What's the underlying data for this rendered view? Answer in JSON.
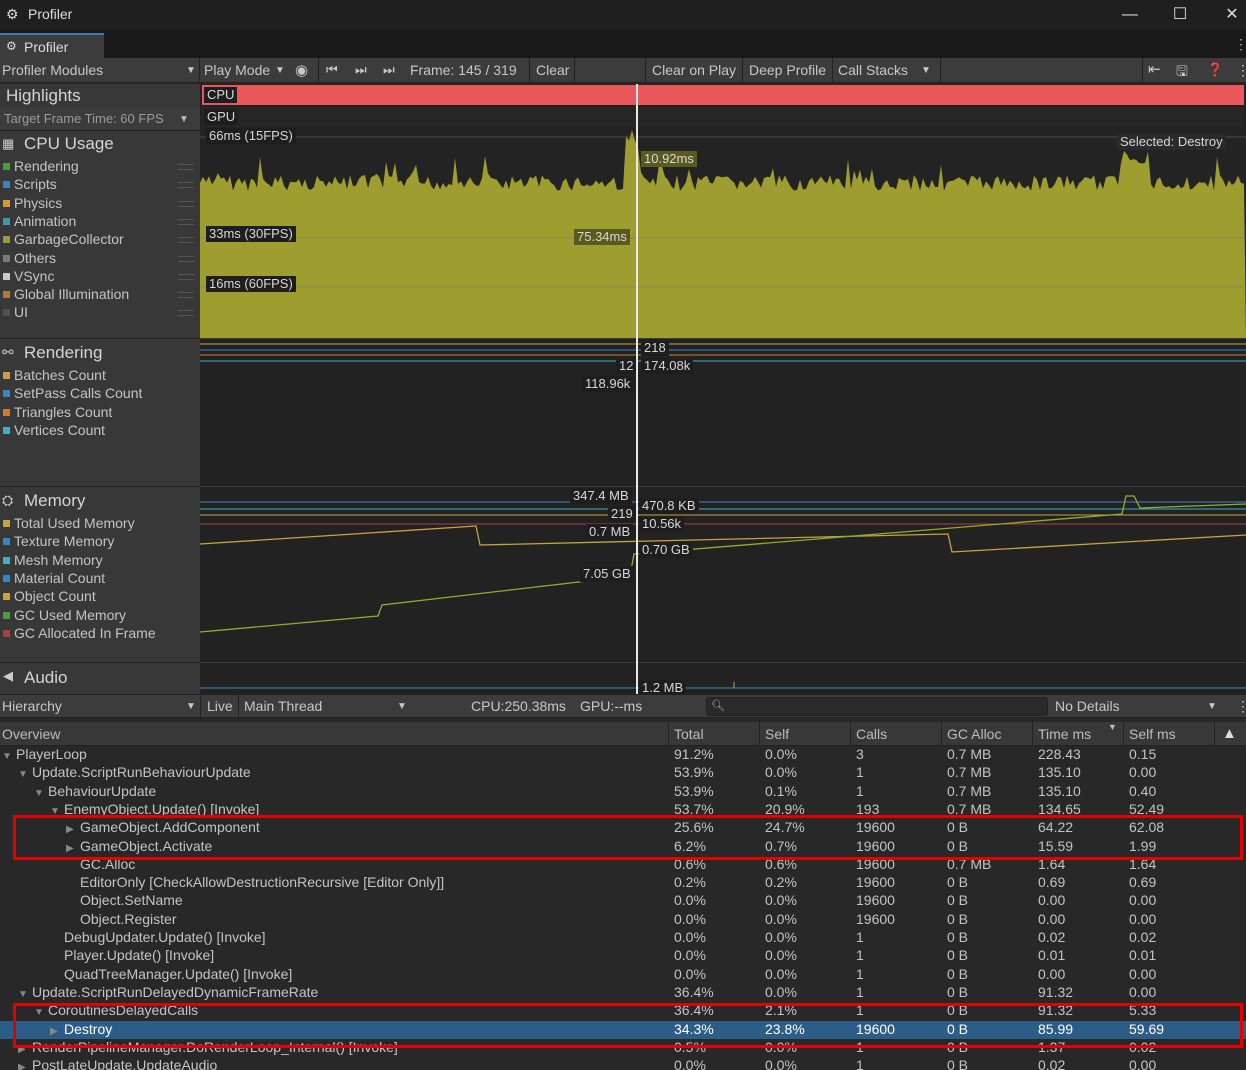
{
  "window": {
    "title": "Profiler",
    "tab": "Profiler"
  },
  "toolbar": {
    "modules": "Profiler Modules",
    "play_mode": "Play Mode",
    "frame": "Frame: 145 / 319",
    "clear": "Clear",
    "clear_on_play": "Clear on Play",
    "deep_profile": "Deep Profile",
    "call_stacks": "Call Stacks"
  },
  "highlights": {
    "title": "Highlights",
    "target": "Target Frame Time: 60 FPS",
    "cpu": "CPU",
    "gpu": "GPU"
  },
  "cpu_module": {
    "title": "CPU Usage",
    "legend": [
      {
        "label": "Rendering",
        "color": "#4e9a3d"
      },
      {
        "label": "Scripts",
        "color": "#3b84c4"
      },
      {
        "label": "Physics",
        "color": "#d09b2b"
      },
      {
        "label": "Animation",
        "color": "#3d99a6"
      },
      {
        "label": "GarbageCollector",
        "color": "#9a9a3d"
      },
      {
        "label": "Others",
        "color": "#7a7a7a"
      },
      {
        "label": "VSync",
        "color": "#c8c8c8"
      },
      {
        "label": "Global Illumination",
        "color": "#b07a3d"
      },
      {
        "label": "UI",
        "color": "#505050"
      }
    ],
    "labels": {
      "fps15": "66ms (15FPS)",
      "fps30": "33ms (30FPS)",
      "fps60": "16ms (60FPS)",
      "selected": "Selected: Destroy",
      "val1": "10.92ms",
      "val2": "75.34ms"
    }
  },
  "rendering_module": {
    "title": "Rendering",
    "legend": [
      {
        "label": "Batches Count",
        "color": "#c8a33d"
      },
      {
        "label": "SetPass Calls Count",
        "color": "#3b84c4"
      },
      {
        "label": "Triangles Count",
        "color": "#d07a2b"
      },
      {
        "label": "Vertices Count",
        "color": "#3db0c4"
      }
    ],
    "labels": {
      "a": "218",
      "b": "12",
      "c": "174.08k",
      "d": "118.96k"
    }
  },
  "memory_module": {
    "title": "Memory",
    "legend": [
      {
        "label": "Total Used Memory",
        "color": "#c8a33d"
      },
      {
        "label": "Texture Memory",
        "color": "#3b84c4"
      },
      {
        "label": "Mesh Memory",
        "color": "#3db0c4"
      },
      {
        "label": "Material Count",
        "color": "#3b84c4"
      },
      {
        "label": "Object Count",
        "color": "#c8a33d"
      },
      {
        "label": "GC Used Memory",
        "color": "#4e9a3d"
      },
      {
        "label": "GC Allocated In Frame",
        "color": "#b03d3d"
      }
    ],
    "labels": {
      "a": "347.4 MB",
      "b": "219",
      "c": "0.7 MB",
      "d": "7.05 GB",
      "e": "470.8 KB",
      "f": "10.56k",
      "g": "0.70 GB"
    }
  },
  "audio_module": {
    "title": "Audio",
    "label": "1.2 MB"
  },
  "hierarchy_bar": {
    "view": "Hierarchy",
    "live": "Live",
    "thread": "Main Thread",
    "cpu": "CPU:250.38ms",
    "gpu": "GPU:--ms",
    "details": "No Details"
  },
  "columns": [
    "Overview",
    "Total",
    "Self",
    "Calls",
    "GC Alloc",
    "Time ms",
    "Self ms"
  ],
  "rows": [
    {
      "indent": 0,
      "arrow": "▼",
      "name": "PlayerLoop",
      "total": "91.2%",
      "self": "0.0%",
      "calls": "3",
      "gc": "0.7 MB",
      "time": "228.43",
      "selfms": "0.15"
    },
    {
      "indent": 1,
      "arrow": "▼",
      "name": "Update.ScriptRunBehaviourUpdate",
      "total": "53.9%",
      "self": "0.0%",
      "calls": "1",
      "gc": "0.7 MB",
      "time": "135.10",
      "selfms": "0.00"
    },
    {
      "indent": 2,
      "arrow": "▼",
      "name": "BehaviourUpdate",
      "total": "53.9%",
      "self": "0.1%",
      "calls": "1",
      "gc": "0.7 MB",
      "time": "135.10",
      "selfms": "0.40"
    },
    {
      "indent": 3,
      "arrow": "▼",
      "name": "EnemyObject.Update() [Invoke]",
      "total": "53.7%",
      "self": "20.9%",
      "calls": "193",
      "gc": "0.7 MB",
      "time": "134.65",
      "selfms": "52.49"
    },
    {
      "indent": 4,
      "arrow": "▶",
      "name": "GameObject.AddComponent",
      "total": "25.6%",
      "self": "24.7%",
      "calls": "19600",
      "gc": "0 B",
      "time": "64.22",
      "selfms": "62.08"
    },
    {
      "indent": 4,
      "arrow": "▶",
      "name": "GameObject.Activate",
      "total": "6.2%",
      "self": "0.7%",
      "calls": "19600",
      "gc": "0 B",
      "time": "15.59",
      "selfms": "1.99"
    },
    {
      "indent": 4,
      "arrow": "",
      "name": "GC.Alloc",
      "total": "0.6%",
      "self": "0.6%",
      "calls": "19600",
      "gc": "0.7 MB",
      "time": "1.64",
      "selfms": "1.64"
    },
    {
      "indent": 4,
      "arrow": "",
      "name": "EditorOnly [CheckAllowDestructionRecursive [Editor Only]]",
      "total": "0.2%",
      "self": "0.2%",
      "calls": "19600",
      "gc": "0 B",
      "time": "0.69",
      "selfms": "0.69"
    },
    {
      "indent": 4,
      "arrow": "",
      "name": "Object.SetName",
      "total": "0.0%",
      "self": "0.0%",
      "calls": "19600",
      "gc": "0 B",
      "time": "0.00",
      "selfms": "0.00"
    },
    {
      "indent": 4,
      "arrow": "",
      "name": "Object.Register",
      "total": "0.0%",
      "self": "0.0%",
      "calls": "19600",
      "gc": "0 B",
      "time": "0.00",
      "selfms": "0.00"
    },
    {
      "indent": 3,
      "arrow": "",
      "name": "DebugUpdater.Update() [Invoke]",
      "total": "0.0%",
      "self": "0.0%",
      "calls": "1",
      "gc": "0 B",
      "time": "0.02",
      "selfms": "0.02"
    },
    {
      "indent": 3,
      "arrow": "",
      "name": "Player.Update() [Invoke]",
      "total": "0.0%",
      "self": "0.0%",
      "calls": "1",
      "gc": "0 B",
      "time": "0.01",
      "selfms": "0.01"
    },
    {
      "indent": 3,
      "arrow": "",
      "name": "QuadTreeManager.Update() [Invoke]",
      "total": "0.0%",
      "self": "0.0%",
      "calls": "1",
      "gc": "0 B",
      "time": "0.00",
      "selfms": "0.00"
    },
    {
      "indent": 1,
      "arrow": "▼",
      "name": "Update.ScriptRunDelayedDynamicFrameRate",
      "total": "36.4%",
      "self": "0.0%",
      "calls": "1",
      "gc": "0 B",
      "time": "91.32",
      "selfms": "0.00"
    },
    {
      "indent": 2,
      "arrow": "▼",
      "name": "CoroutinesDelayedCalls",
      "total": "36.4%",
      "self": "2.1%",
      "calls": "1",
      "gc": "0 B",
      "time": "91.32",
      "selfms": "5.33"
    },
    {
      "indent": 3,
      "arrow": "▶",
      "name": "Destroy",
      "total": "34.3%",
      "self": "23.8%",
      "calls": "19600",
      "gc": "0 B",
      "time": "85.99",
      "selfms": "59.69",
      "selected": true
    },
    {
      "indent": 1,
      "arrow": "▶",
      "name": "RenderPipelineManager.DoRenderLoop_Internal() [Invoke]",
      "total": "0.5%",
      "self": "0.0%",
      "calls": "1",
      "gc": "0 B",
      "time": "1.37",
      "selfms": "0.02"
    },
    {
      "indent": 1,
      "arrow": "▶",
      "name": "PostLateUpdate.UpdateAudio",
      "total": "0.0%",
      "self": "0.0%",
      "calls": "1",
      "gc": "0 B",
      "time": "0.02",
      "selfms": "0.00"
    }
  ]
}
